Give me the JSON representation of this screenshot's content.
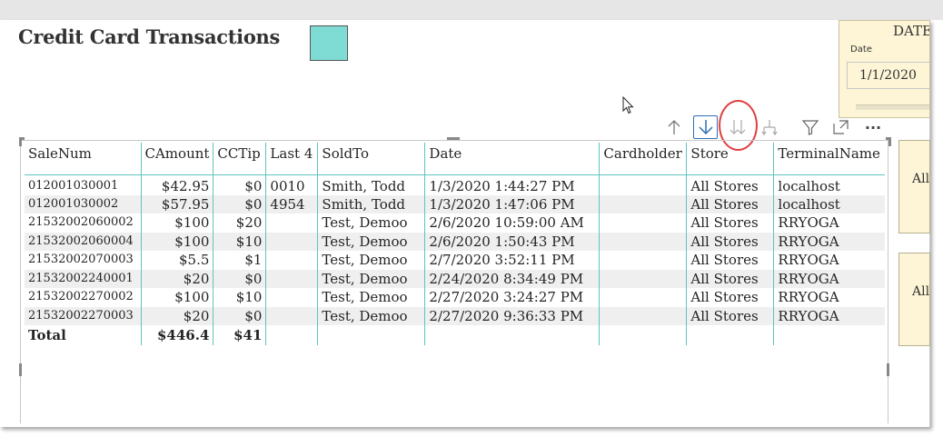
{
  "report": {
    "title": "Credit Card Transactions"
  },
  "colors": {
    "swatch": "#7fdcd4",
    "card_bg": "#fdf5d6",
    "grid_line": "#5fc4bb",
    "focus_icon": "#2e6fb5",
    "annotation_circle": "#e04040"
  },
  "date_card": {
    "title": "DATE",
    "label": "Date",
    "value": "1/1/2020"
  },
  "slicers": [
    {
      "label": "All"
    },
    {
      "label": "All"
    }
  ],
  "toolbar": {
    "icons": [
      "drill-up-icon",
      "drill-down-icon",
      "expand-next-level-icon",
      "expand-hierarchy-icon",
      "filter-icon",
      "focus-mode-icon",
      "more-options-icon"
    ],
    "more_label": "···"
  },
  "table": {
    "columns": [
      "SaleNum",
      "CAmount",
      "CCTip",
      "Last 4",
      "SoldTo",
      "Date",
      "Cardholder",
      "Store",
      "TerminalName"
    ],
    "rows": [
      [
        "012001030001",
        "$42.95",
        "$0",
        "0010",
        "Smith, Todd",
        "1/3/2020 1:44:27 PM",
        "",
        "All Stores",
        "localhost"
      ],
      [
        "012001030002",
        "$57.95",
        "$0",
        "4954",
        "Smith, Todd",
        "1/3/2020 1:47:06 PM",
        "",
        "All Stores",
        "localhost"
      ],
      [
        "21532002060002",
        "$100",
        "$20",
        "",
        "Test, Demoo",
        "2/6/2020 10:59:00 AM",
        "",
        "All Stores",
        "RRYOGA"
      ],
      [
        "21532002060004",
        "$100",
        "$10",
        "",
        "Test, Demoo",
        "2/6/2020 1:50:43 PM",
        "",
        "All Stores",
        "RRYOGA"
      ],
      [
        "21532002070003",
        "$5.5",
        "$1",
        "",
        "Test, Demoo",
        "2/7/2020 3:52:11 PM",
        "",
        "All Stores",
        "RRYOGA"
      ],
      [
        "21532002240001",
        "$20",
        "$0",
        "",
        "Test, Demoo",
        "2/24/2020 8:34:49 PM",
        "",
        "All Stores",
        "RRYOGA"
      ],
      [
        "21532002270002",
        "$100",
        "$10",
        "",
        "Test, Demoo",
        "2/27/2020 3:24:27 PM",
        "",
        "All Stores",
        "RRYOGA"
      ],
      [
        "21532002270003",
        "$20",
        "$0",
        "",
        "Test, Demoo",
        "2/27/2020 9:36:33 PM",
        "",
        "All Stores",
        "RRYOGA"
      ]
    ],
    "total": [
      "Total",
      "$446.4",
      "$41",
      "",
      "",
      "",
      "",
      "",
      ""
    ]
  }
}
